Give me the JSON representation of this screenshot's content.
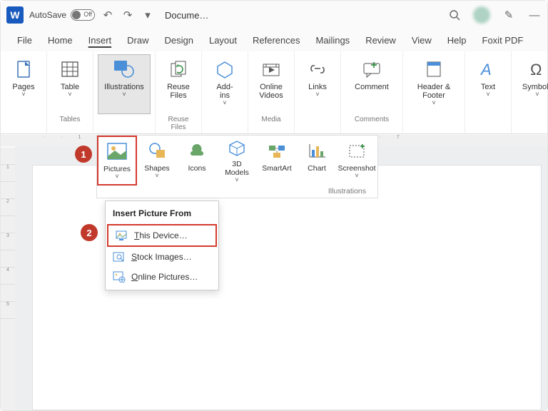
{
  "titlebar": {
    "autosave_label": "AutoSave",
    "autosave_off": "Off",
    "doc_title": "Docume…"
  },
  "tabs": [
    "File",
    "Home",
    "Insert",
    "Draw",
    "Design",
    "Layout",
    "References",
    "Mailings",
    "Review",
    "View",
    "Help",
    "Foxit PDF"
  ],
  "active_tab": "Insert",
  "ribbon": {
    "groups": [
      {
        "label": "",
        "buttons": [
          {
            "name": "Pages",
            "caret": true
          }
        ]
      },
      {
        "label": "Tables",
        "buttons": [
          {
            "name": "Table",
            "caret": true
          }
        ]
      },
      {
        "label": "",
        "buttons": [
          {
            "name": "Illustrations",
            "caret": true,
            "active": true
          }
        ]
      },
      {
        "label": "Reuse Files",
        "buttons": [
          {
            "name": "Reuse\nFiles"
          }
        ]
      },
      {
        "label": "",
        "buttons": [
          {
            "name": "Add-\nins",
            "caret": true
          }
        ]
      },
      {
        "label": "Media",
        "buttons": [
          {
            "name": "Online\nVideos"
          }
        ]
      },
      {
        "label": "",
        "buttons": [
          {
            "name": "Links",
            "caret": true
          }
        ]
      },
      {
        "label": "Comments",
        "buttons": [
          {
            "name": "Comment",
            "wide": true
          }
        ]
      },
      {
        "label": "",
        "buttons": [
          {
            "name": "Header &\nFooter",
            "caret": true,
            "wide": true
          }
        ]
      },
      {
        "label": "",
        "buttons": [
          {
            "name": "Text",
            "caret": true
          }
        ]
      },
      {
        "label": "",
        "buttons": [
          {
            "name": "Symbols",
            "caret": true
          }
        ]
      }
    ]
  },
  "illustrations": {
    "label": "Illustrations",
    "buttons": [
      "Pictures",
      "Shapes",
      "Icons",
      "3D\nModels",
      "SmartArt",
      "Chart",
      "Screenshot"
    ],
    "carets": [
      true,
      true,
      false,
      true,
      false,
      false,
      true
    ],
    "highlight_index": 0
  },
  "dropdown": {
    "header": "Insert Picture From",
    "items": [
      "This Device…",
      "Stock Images…",
      "Online Pictures…"
    ],
    "highlight_index": 0
  },
  "callouts": {
    "1": "1",
    "2": "2"
  }
}
